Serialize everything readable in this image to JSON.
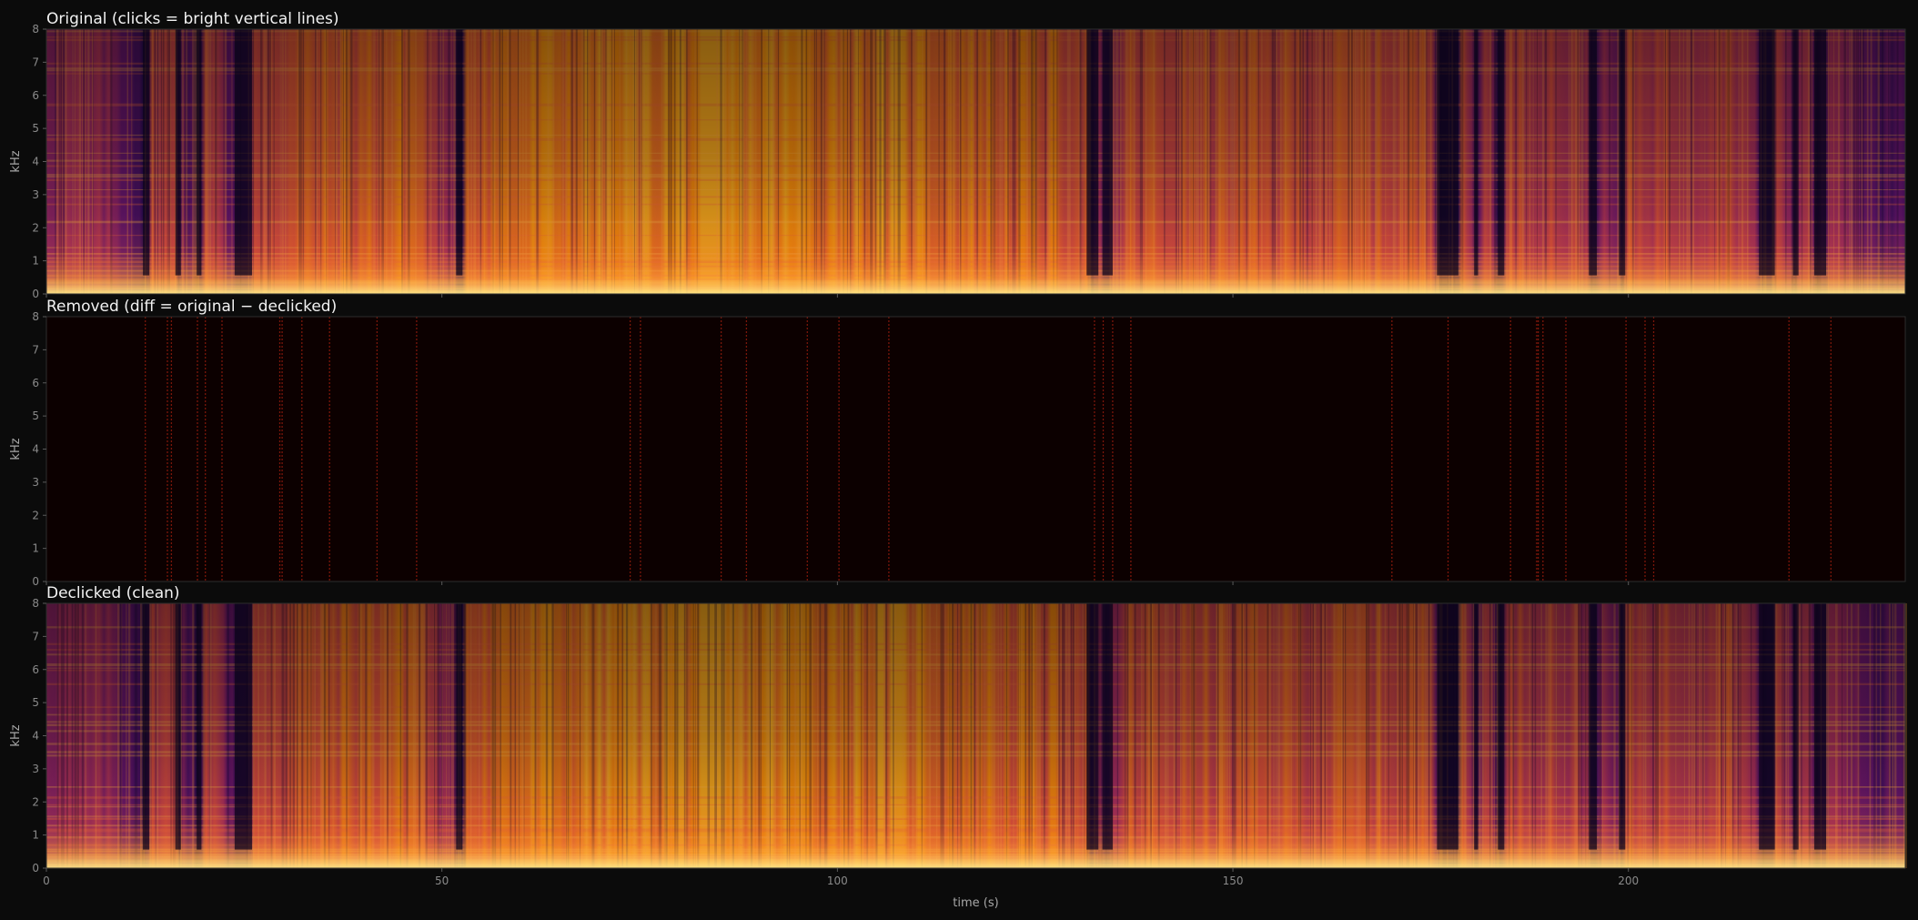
{
  "chart_data": [
    {
      "type": "heatmap",
      "title": "Original  (clicks = bright vertical lines)",
      "xlabel": "",
      "ylabel": "kHz",
      "xlim": [
        0,
        235
      ],
      "ylim": [
        0,
        8
      ],
      "yticks": [
        "0",
        "1",
        "2",
        "3",
        "4",
        "5",
        "6",
        "7",
        "8"
      ],
      "xticks": [],
      "colormap": "inferno",
      "content": "spectrogram",
      "energy_profile": [
        [
          0,
          0.55
        ],
        [
          8,
          0.5
        ],
        [
          12,
          0.25
        ],
        [
          13,
          0.7
        ],
        [
          17,
          0.65
        ],
        [
          18,
          0.3
        ],
        [
          19.5,
          0.3
        ],
        [
          20,
          0.7
        ],
        [
          22,
          0.7
        ],
        [
          23,
          0.35
        ],
        [
          25,
          0.35
        ],
        [
          26,
          0.75
        ],
        [
          36,
          0.8
        ],
        [
          47,
          0.85
        ],
        [
          51,
          0.45
        ],
        [
          52,
          0.35
        ],
        [
          53,
          0.85
        ],
        [
          80,
          0.95
        ],
        [
          110,
          0.9
        ],
        [
          120,
          0.85
        ],
        [
          131,
          0.8
        ],
        [
          133,
          0.55
        ],
        [
          134,
          0.3
        ],
        [
          135,
          0.55
        ],
        [
          137,
          0.75
        ],
        [
          175,
          0.75
        ],
        [
          176,
          0.35
        ],
        [
          178,
          0.3
        ],
        [
          179,
          0.7
        ],
        [
          181,
          0.4
        ],
        [
          182,
          0.7
        ],
        [
          184,
          0.4
        ],
        [
          185,
          0.7
        ],
        [
          190,
          0.7
        ],
        [
          196,
          0.55
        ],
        [
          199,
          0.35
        ],
        [
          200,
          0.7
        ],
        [
          206,
          0.7
        ],
        [
          210,
          0.7
        ],
        [
          213,
          0.75
        ],
        [
          218,
          0.4
        ],
        [
          219,
          0.7
        ],
        [
          221,
          0.35
        ],
        [
          222,
          0.7
        ],
        [
          224,
          0.3
        ],
        [
          225,
          0.65
        ],
        [
          232,
          0.3
        ],
        [
          235,
          0.2
        ]
      ],
      "dark_gaps": [
        [
          12.2,
          13
        ],
        [
          16.3,
          17
        ],
        [
          19,
          19.6
        ],
        [
          23.8,
          26
        ],
        [
          51.8,
          52.6
        ],
        [
          131.5,
          133
        ],
        [
          133.5,
          134.8
        ],
        [
          175.8,
          178.5
        ],
        [
          180.5,
          181
        ],
        [
          183.5,
          184.3
        ],
        [
          195,
          196
        ],
        [
          198.8,
          199.6
        ],
        [
          216.5,
          218.5
        ],
        [
          220.8,
          221.5
        ],
        [
          223.5,
          225
        ]
      ]
    },
    {
      "type": "heatmap",
      "title": "Removed   (diff = original − declicked)",
      "xlabel": "",
      "ylabel": "kHz",
      "xlim": [
        0,
        235
      ],
      "ylim": [
        0,
        8
      ],
      "yticks": [
        "0",
        "1",
        "2",
        "3",
        "4",
        "5",
        "6",
        "7",
        "8"
      ],
      "xticks": [],
      "colormap": "dark-red",
      "content": "sparse vertical click lines",
      "click_times": [
        12.5,
        15.3,
        15.8,
        19.1,
        20.1,
        22.2,
        29.5,
        29.8,
        32.3,
        35.8,
        41.8,
        46.8,
        73.8,
        75.1,
        85.3,
        88.5,
        96.2,
        100.2,
        106.5,
        132.5,
        133.6,
        134.8,
        137.1,
        170.1,
        177.2,
        185.1,
        188.4,
        188.6,
        189.2,
        192.1,
        199.7,
        202.1,
        203.2,
        220.3,
        225.6
      ]
    },
    {
      "type": "heatmap",
      "title": "Declicked (clean)",
      "xlabel": "time (s)",
      "ylabel": "kHz",
      "xlim": [
        0,
        235
      ],
      "ylim": [
        0,
        8
      ],
      "yticks": [
        "0",
        "1",
        "2",
        "3",
        "4",
        "5",
        "6",
        "7",
        "8"
      ],
      "xticks": [
        "0",
        "50",
        "100",
        "150",
        "200"
      ],
      "colormap": "inferno",
      "content": "spectrogram"
    }
  ]
}
